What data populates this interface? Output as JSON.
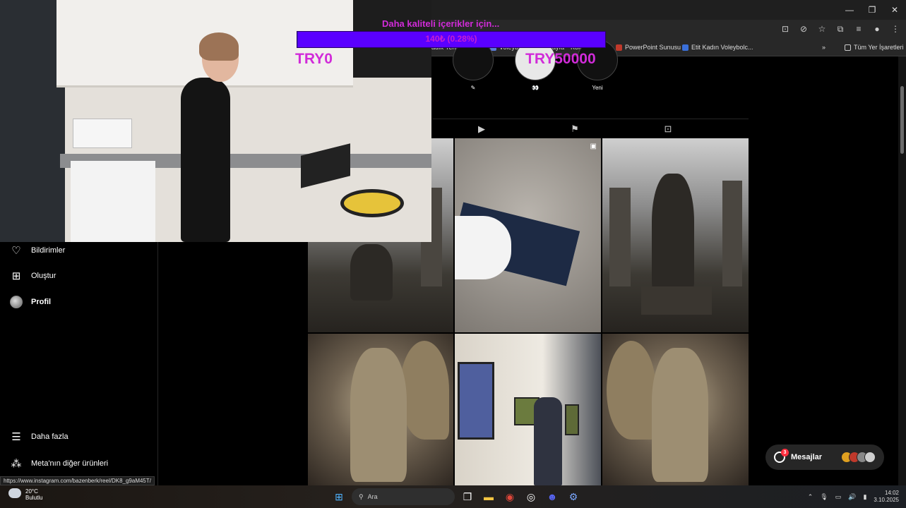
{
  "browser": {
    "window_controls": [
      "—",
      "❐",
      "✕"
    ],
    "bookmarks": [
      {
        "label": "Sadık Yerlemedi Radalı",
        "color": "#777"
      },
      {
        "label": "Voleybolcu.kadın sayfa",
        "color": "#5a7cd9"
      },
      {
        "label": "Koleksiyon",
        "color": "#888"
      },
      {
        "label": "PowerPoint Sunusu",
        "color": "#c0392b"
      },
      {
        "label": "Etit Kadın Voleybolc...",
        "color": "#3a6fd9"
      },
      {
        "label": "Tüm Yer İşaretleri",
        "color": "#999"
      }
    ],
    "overflow_chevron": "»",
    "status_url": "https://www.instagram.com/bazenberk/reel/DK8_g9aM45T/"
  },
  "stream_overlay": {
    "donation_title": "Daha kaliteli içerikler için...",
    "progress_text": "140₺ (0.28%)",
    "progress_fraction": 0.0028,
    "goal_min": "TRY0",
    "goal_max": "TRY50000"
  },
  "sidebar": {
    "items": [
      {
        "label": "Bildirimler",
        "icon": "heart-icon"
      },
      {
        "label": "Oluştur",
        "icon": "plus-square-icon"
      },
      {
        "label": "Profil",
        "icon": "avatar"
      },
      {
        "label": "Daha fazla",
        "icon": "menu-icon"
      },
      {
        "label": "Meta'nın diğer ürünleri",
        "icon": "meta-grid-icon"
      }
    ]
  },
  "profile": {
    "highlights": [
      {
        "label": ""
      },
      {
        "label": "👀"
      },
      {
        "label": "Yeni"
      }
    ],
    "tabs": [
      "reels-tab",
      "saved-tab",
      "tagged-tab"
    ]
  },
  "messages": {
    "label": "Mesajlar",
    "badge": "3"
  },
  "taskbar": {
    "weather_temp": "20°C",
    "weather_desc": "Bulutlu",
    "search_placeholder": "Ara",
    "time": "14:02",
    "date": "3.10.2025"
  },
  "colors": {
    "overlay_magenta": "#d12bd9",
    "progress_bar": "#5a00ff",
    "instagram_bg": "#000000",
    "notification_red": "#ff3040"
  }
}
